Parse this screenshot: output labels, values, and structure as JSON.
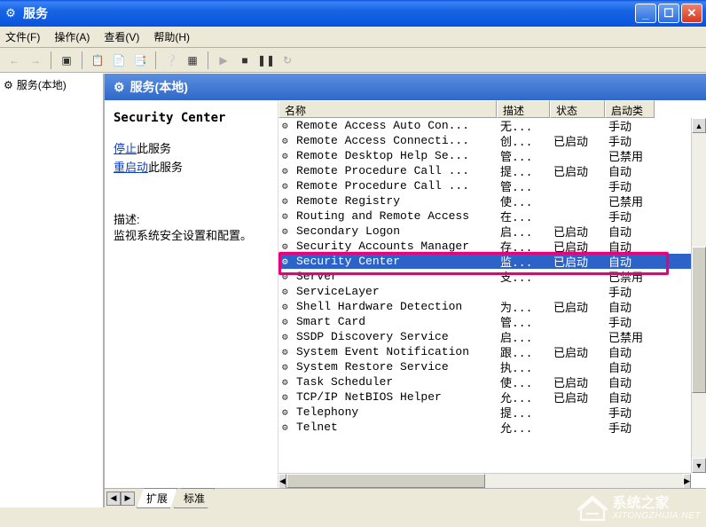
{
  "window": {
    "title": "服务"
  },
  "menu": {
    "file": "文件(F)",
    "action": "操作(A)",
    "view": "查看(V)",
    "help": "帮助(H)"
  },
  "tree": {
    "root": "服务(本地)"
  },
  "content_header": "服务(本地)",
  "info": {
    "selected_name": "Security Center",
    "stop_link": "停止",
    "stop_suffix": "此服务",
    "restart_link": "重启动",
    "restart_suffix": "此服务",
    "desc_label": "描述:",
    "desc_text": "监视系统安全设置和配置。"
  },
  "columns": {
    "name": "名称",
    "desc": "描述",
    "status": "状态",
    "startup": "启动类"
  },
  "services": [
    {
      "name": "Remote Access Auto Con...",
      "desc": "无...",
      "status": "",
      "startup": "手动"
    },
    {
      "name": "Remote Access Connecti...",
      "desc": "创...",
      "status": "已启动",
      "startup": "手动"
    },
    {
      "name": "Remote Desktop Help Se...",
      "desc": "管...",
      "status": "",
      "startup": "已禁用"
    },
    {
      "name": "Remote Procedure Call ...",
      "desc": "提...",
      "status": "已启动",
      "startup": "自动"
    },
    {
      "name": "Remote Procedure Call ...",
      "desc": "管...",
      "status": "",
      "startup": "手动"
    },
    {
      "name": "Remote Registry",
      "desc": "使...",
      "status": "",
      "startup": "已禁用"
    },
    {
      "name": "Routing and Remote Access",
      "desc": "在...",
      "status": "",
      "startup": "手动"
    },
    {
      "name": "Secondary Logon",
      "desc": "启...",
      "status": "已启动",
      "startup": "自动"
    },
    {
      "name": "Security Accounts Manager",
      "desc": "存...",
      "status": "已启动",
      "startup": "自动"
    },
    {
      "name": "Security Center",
      "desc": "监...",
      "status": "已启动",
      "startup": "自动",
      "selected": true
    },
    {
      "name": "Server",
      "desc": "支...",
      "status": "",
      "startup": "已禁用"
    },
    {
      "name": "ServiceLayer",
      "desc": "",
      "status": "",
      "startup": "手动"
    },
    {
      "name": "Shell Hardware Detection",
      "desc": "为...",
      "status": "已启动",
      "startup": "自动"
    },
    {
      "name": "Smart Card",
      "desc": "管...",
      "status": "",
      "startup": "手动"
    },
    {
      "name": "SSDP Discovery Service",
      "desc": "启...",
      "status": "",
      "startup": "已禁用"
    },
    {
      "name": "System Event Notification",
      "desc": "跟...",
      "status": "已启动",
      "startup": "自动"
    },
    {
      "name": "System Restore Service",
      "desc": "执...",
      "status": "",
      "startup": "自动"
    },
    {
      "name": "Task Scheduler",
      "desc": "使...",
      "status": "已启动",
      "startup": "自动"
    },
    {
      "name": "TCP/IP NetBIOS Helper",
      "desc": "允...",
      "status": "已启动",
      "startup": "自动"
    },
    {
      "name": "Telephony",
      "desc": "提...",
      "status": "",
      "startup": "手动"
    },
    {
      "name": "Telnet",
      "desc": "允...",
      "status": "",
      "startup": "手动"
    }
  ],
  "tabs": {
    "extended": "扩展",
    "standard": "标准"
  },
  "watermark": {
    "zh": "系统之家",
    "url": "XITONGZHIJIA.NET"
  }
}
